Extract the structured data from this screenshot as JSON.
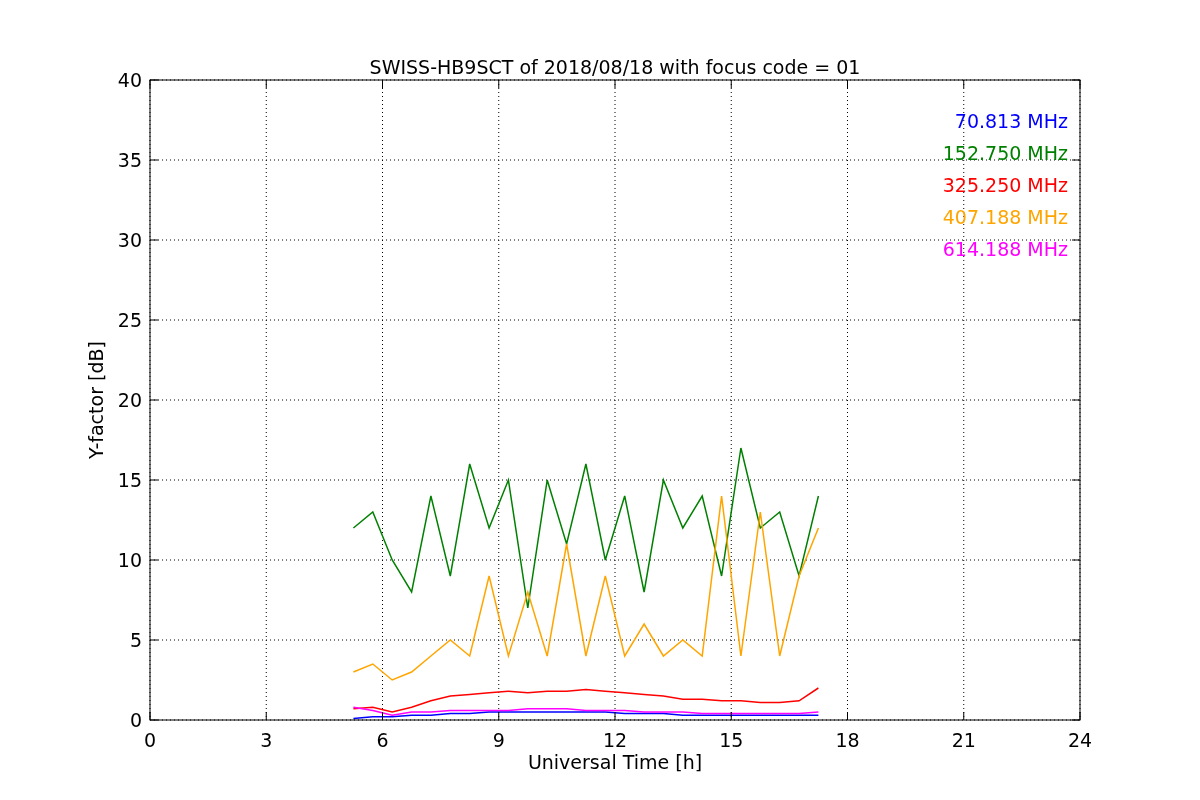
{
  "chart": {
    "chart_data": {
      "type": "line",
      "title": "SWISS-HB9SCT of 2018/08/18 with focus code = 01",
      "xlabel": "Universal Time [h]",
      "ylabel": "Y-factor [dB]",
      "x": [
        5.25,
        5.75,
        6.25,
        6.75,
        7.25,
        7.75,
        8.25,
        8.75,
        9.25,
        9.75,
        10.25,
        10.75,
        11.25,
        11.75,
        12.25,
        12.75,
        13.25,
        13.75,
        14.25,
        14.75,
        15.25,
        15.75,
        16.25,
        16.75,
        17.25
      ],
      "series": [
        {
          "name": "70.813 MHz",
          "color": "#0000ff",
          "values": [
            0.1,
            0.2,
            0.2,
            0.3,
            0.3,
            0.4,
            0.4,
            0.5,
            0.5,
            0.5,
            0.5,
            0.5,
            0.5,
            0.5,
            0.4,
            0.4,
            0.4,
            0.3,
            0.3,
            0.3,
            0.3,
            0.3,
            0.3,
            0.3,
            0.3
          ]
        },
        {
          "name": "152.750 MHz",
          "color": "#008000",
          "values": [
            12,
            13,
            10,
            8,
            14,
            9,
            16,
            12,
            15,
            7,
            15,
            11,
            16,
            10,
            14,
            8,
            15,
            12,
            14,
            9,
            17,
            12,
            13,
            9,
            14
          ]
        },
        {
          "name": "325.250 MHz",
          "color": "#ff0000",
          "values": [
            0.7,
            0.8,
            0.5,
            0.8,
            1.2,
            1.5,
            1.6,
            1.7,
            1.8,
            1.7,
            1.8,
            1.8,
            1.9,
            1.8,
            1.7,
            1.6,
            1.5,
            1.3,
            1.3,
            1.2,
            1.2,
            1.1,
            1.1,
            1.2,
            2
          ]
        },
        {
          "name": "407.188 MHz",
          "color": "#ffa500",
          "values": [
            3,
            3.5,
            2.5,
            3,
            4,
            5,
            4,
            9,
            4,
            8,
            4,
            11,
            4,
            9,
            4,
            6,
            4,
            5,
            4,
            14,
            4,
            13,
            4,
            9,
            12
          ]
        },
        {
          "name": "614.188 MHz",
          "color": "#ff00ff",
          "values": [
            0.8,
            0.6,
            0.3,
            0.5,
            0.5,
            0.6,
            0.6,
            0.6,
            0.6,
            0.7,
            0.7,
            0.7,
            0.6,
            0.6,
            0.6,
            0.5,
            0.5,
            0.5,
            0.4,
            0.4,
            0.4,
            0.4,
            0.4,
            0.4,
            0.5
          ]
        }
      ],
      "xlim": [
        0,
        24
      ],
      "ylim": [
        0,
        40
      ],
      "xticks": [
        0,
        3,
        6,
        9,
        12,
        15,
        18,
        21,
        24
      ],
      "yticks": [
        0,
        5,
        10,
        15,
        20,
        25,
        30,
        35,
        40
      ],
      "grid": true
    }
  }
}
